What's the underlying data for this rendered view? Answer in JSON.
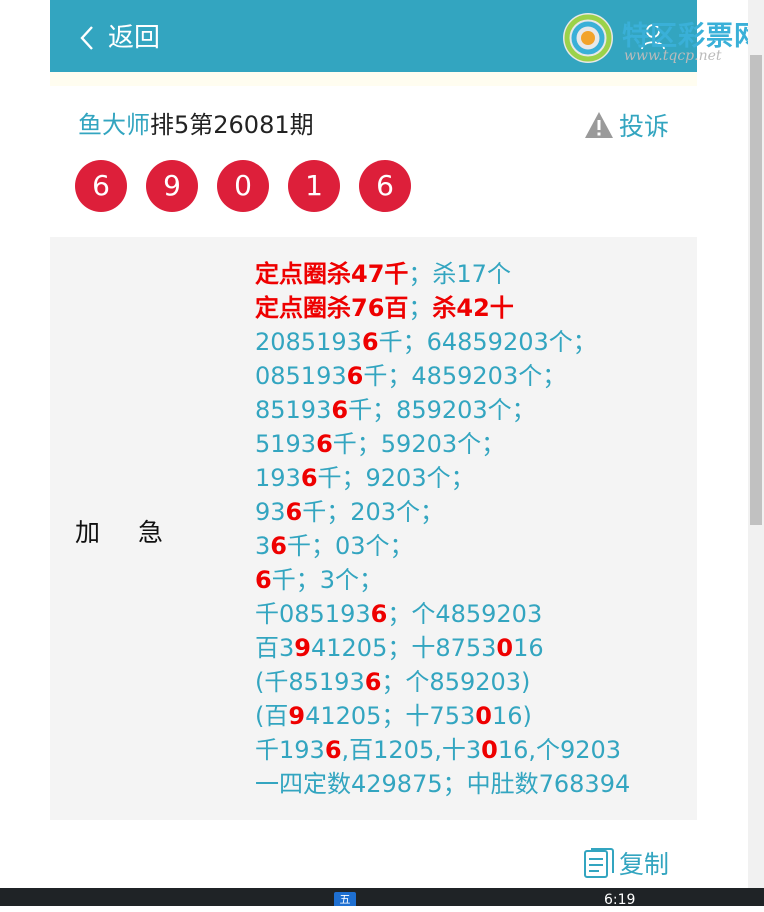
{
  "header": {
    "back_label": "返回"
  },
  "watermark": {
    "name": "特区彩票网",
    "url": "www.tqcp.net"
  },
  "title": {
    "author": "鱼大师",
    "issue": "排5第26081期"
  },
  "complain_label": "投诉",
  "balls": [
    "6",
    "9",
    "0",
    "1",
    "6"
  ],
  "panel": {
    "label": "加急",
    "lines": [
      [
        {
          "t": "定点圈杀47千",
          "s": "redb"
        },
        {
          "t": "；杀17个",
          "s": ""
        }
      ],
      [
        {
          "t": "定点圈杀76百",
          "s": "redb"
        },
        {
          "t": "；",
          "s": ""
        },
        {
          "t": "杀42十",
          "s": "redb"
        }
      ],
      [
        {
          "t": "208519",
          "s": ""
        },
        {
          "t": "3",
          "s": ""
        },
        {
          "t": "6",
          "s": "hl"
        },
        {
          "t": "千；64859203个；",
          "s": ""
        }
      ],
      [
        {
          "t": "085193",
          "s": ""
        },
        {
          "t": "6",
          "s": "hl"
        },
        {
          "t": "千；4859203个；",
          "s": ""
        }
      ],
      [
        {
          "t": "85193",
          "s": ""
        },
        {
          "t": "6",
          "s": "hl"
        },
        {
          "t": "千；859203个；",
          "s": ""
        }
      ],
      [
        {
          "t": "5193",
          "s": ""
        },
        {
          "t": "6",
          "s": "hl"
        },
        {
          "t": "千；59203个；",
          "s": ""
        }
      ],
      [
        {
          "t": "193",
          "s": ""
        },
        {
          "t": "6",
          "s": "hl"
        },
        {
          "t": "千；9203个；",
          "s": ""
        }
      ],
      [
        {
          "t": "93",
          "s": ""
        },
        {
          "t": "6",
          "s": "hl"
        },
        {
          "t": "千；203个；",
          "s": ""
        }
      ],
      [
        {
          "t": "3",
          "s": ""
        },
        {
          "t": "6",
          "s": "hl"
        },
        {
          "t": "千；03个；",
          "s": ""
        }
      ],
      [
        {
          "t": "6",
          "s": "hl"
        },
        {
          "t": "千；3个；",
          "s": ""
        }
      ],
      [
        {
          "t": "千085193",
          "s": ""
        },
        {
          "t": "6",
          "s": "hl"
        },
        {
          "t": "；个4859203",
          "s": ""
        }
      ],
      [
        {
          "t": "百3",
          "s": ""
        },
        {
          "t": "9",
          "s": "hl"
        },
        {
          "t": "41205；十8753",
          "s": ""
        },
        {
          "t": "0",
          "s": "hl"
        },
        {
          "t": "16",
          "s": ""
        }
      ],
      [
        {
          "t": "(千85193",
          "s": ""
        },
        {
          "t": "6",
          "s": "hl"
        },
        {
          "t": "；个859203)",
          "s": ""
        }
      ],
      [
        {
          "t": "(百",
          "s": ""
        },
        {
          "t": "9",
          "s": "hl"
        },
        {
          "t": "41205；十753",
          "s": ""
        },
        {
          "t": "0",
          "s": "hl"
        },
        {
          "t": "16)",
          "s": ""
        }
      ],
      [
        {
          "t": "千193",
          "s": ""
        },
        {
          "t": "6",
          "s": "hl"
        },
        {
          "t": ",百1205,十3",
          "s": ""
        },
        {
          "t": "0",
          "s": "hl"
        },
        {
          "t": "16,个9203",
          "s": ""
        }
      ],
      [
        {
          "t": "一四定数429875；中肚数768394",
          "s": ""
        }
      ]
    ]
  },
  "copy_label": "复制",
  "taskbar": {
    "ime": "五",
    "clock": "6:19"
  },
  "colors": {
    "accent": "#33a5c0",
    "ball": "#dd1f3a",
    "highlight": "#ee0000"
  }
}
